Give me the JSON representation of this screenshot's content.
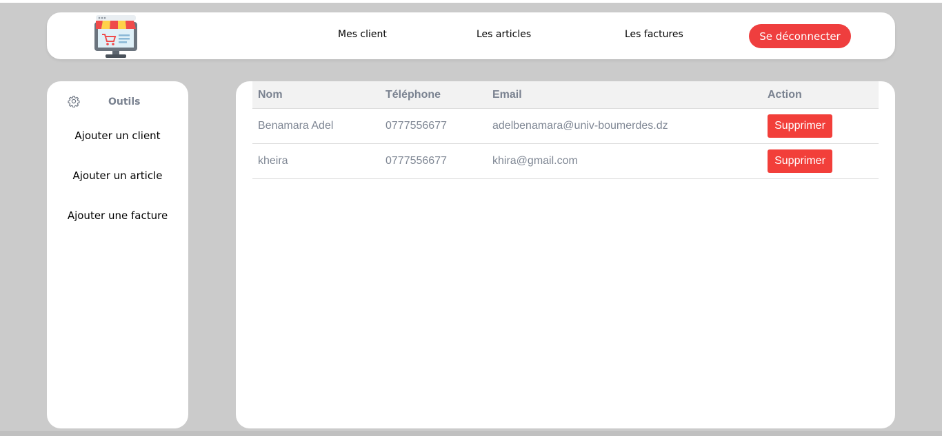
{
  "header": {
    "logo_icon": "shop-monitor-icon",
    "nav": {
      "clients": "Mes client",
      "articles": "Les articles",
      "factures": "Les factures"
    },
    "logout_label": "Se déconnecter"
  },
  "sidebar": {
    "tools_icon": "gear-icon",
    "tools_label": "Outils",
    "items": [
      {
        "label": "Ajouter un client"
      },
      {
        "label": "Ajouter un article"
      },
      {
        "label": "Ajouter une facture"
      }
    ]
  },
  "table": {
    "headers": [
      "Nom",
      "Téléphone",
      "Email",
      "Action"
    ],
    "rows": [
      {
        "nom": "Benamara Adel",
        "telephone": "0777556677",
        "email": "adelbenamara@univ-boumerdes.dz",
        "action": "Supprimer"
      },
      {
        "nom": "kheira",
        "telephone": "0777556677",
        "email": "khira@gmail.com",
        "action": "Supprimer"
      }
    ]
  },
  "colors": {
    "accent_red": "#ef3e3e",
    "background": "#cbcbcb",
    "muted_text": "#7a8290"
  }
}
